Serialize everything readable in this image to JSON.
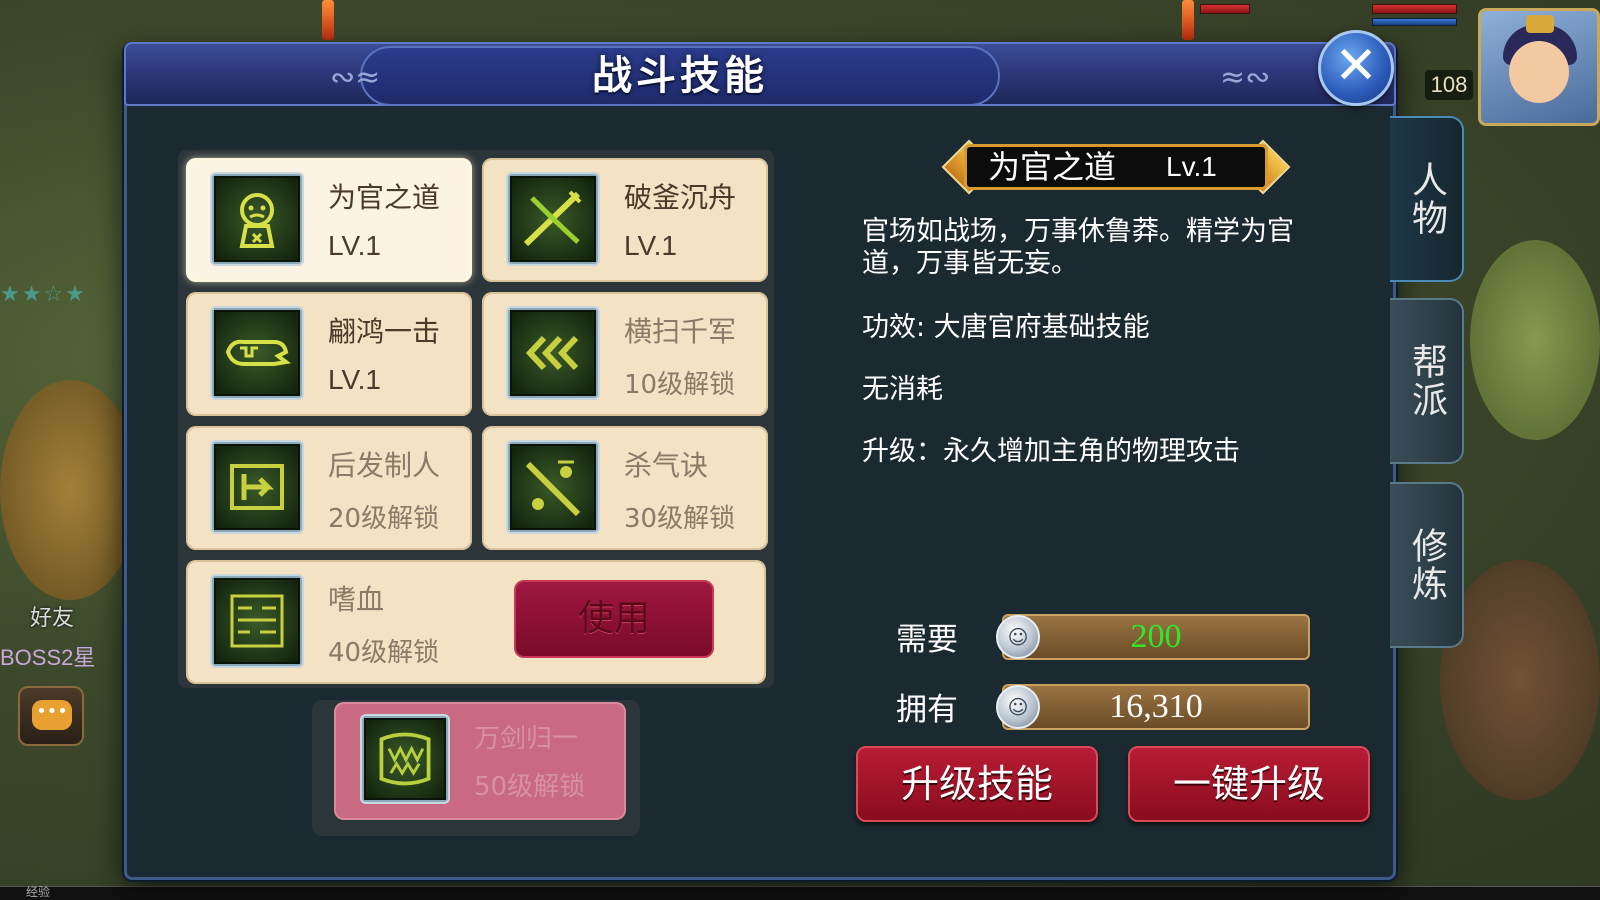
{
  "window": {
    "title": "战斗技能",
    "close_icon": "close-icon"
  },
  "background": {
    "player_level": "108",
    "friend_label": "好友",
    "boss_text": "BOSS2星",
    "exp_label": "经验",
    "rating_stars": "★★☆★"
  },
  "side_tabs": [
    {
      "label": "人物",
      "active": true
    },
    {
      "label": "帮派",
      "active": false
    },
    {
      "label": "修炼",
      "active": false
    }
  ],
  "skills": [
    {
      "name": "为官之道",
      "status": "LV.1",
      "locked": false,
      "selected": true,
      "icon": "worried-face-icon"
    },
    {
      "name": "破釜沉舟",
      "status": "LV.1",
      "locked": false,
      "selected": false,
      "icon": "crossed-swords-icon"
    },
    {
      "name": "翩鸿一击",
      "status": "LV.1",
      "locked": false,
      "selected": false,
      "icon": "bird-strike-icon"
    },
    {
      "name": "横扫千军",
      "status": "10级解锁",
      "locked": true,
      "selected": false,
      "icon": "triple-chevron-icon"
    },
    {
      "name": "后发制人",
      "status": "20级解锁",
      "locked": true,
      "selected": false,
      "icon": "counter-arrow-icon"
    },
    {
      "name": "杀气诀",
      "status": "30级解锁",
      "locked": true,
      "selected": false,
      "icon": "blade-aura-icon"
    },
    {
      "name": "嗜血",
      "status": "40级解锁",
      "locked": true,
      "selected": false,
      "icon": "blood-runes-icon"
    },
    {
      "name": "万剑归一",
      "status": "50级解锁",
      "locked": true,
      "selected": false,
      "icon": "fanged-mouth-icon"
    }
  ],
  "use_button": "使用",
  "detail": {
    "name": "为官之道",
    "level": "Lv.1",
    "description": "官场如战场，万事休鲁莽。精学为官道，万事皆无妄。",
    "effect": "功效: 大唐官府基础技能",
    "cost": "无消耗",
    "upgrade": "升级：永久增加主角的物理攻击"
  },
  "cost": {
    "required_label": "需要",
    "required_value": "200",
    "required_color": "#2ee82a",
    "owned_label": "拥有",
    "owned_value": "16,310",
    "owned_color": "#ffffff",
    "coin_icon": "silver-coin-icon"
  },
  "buttons": {
    "upgrade": "升级技能",
    "one_click": "一键升级"
  }
}
